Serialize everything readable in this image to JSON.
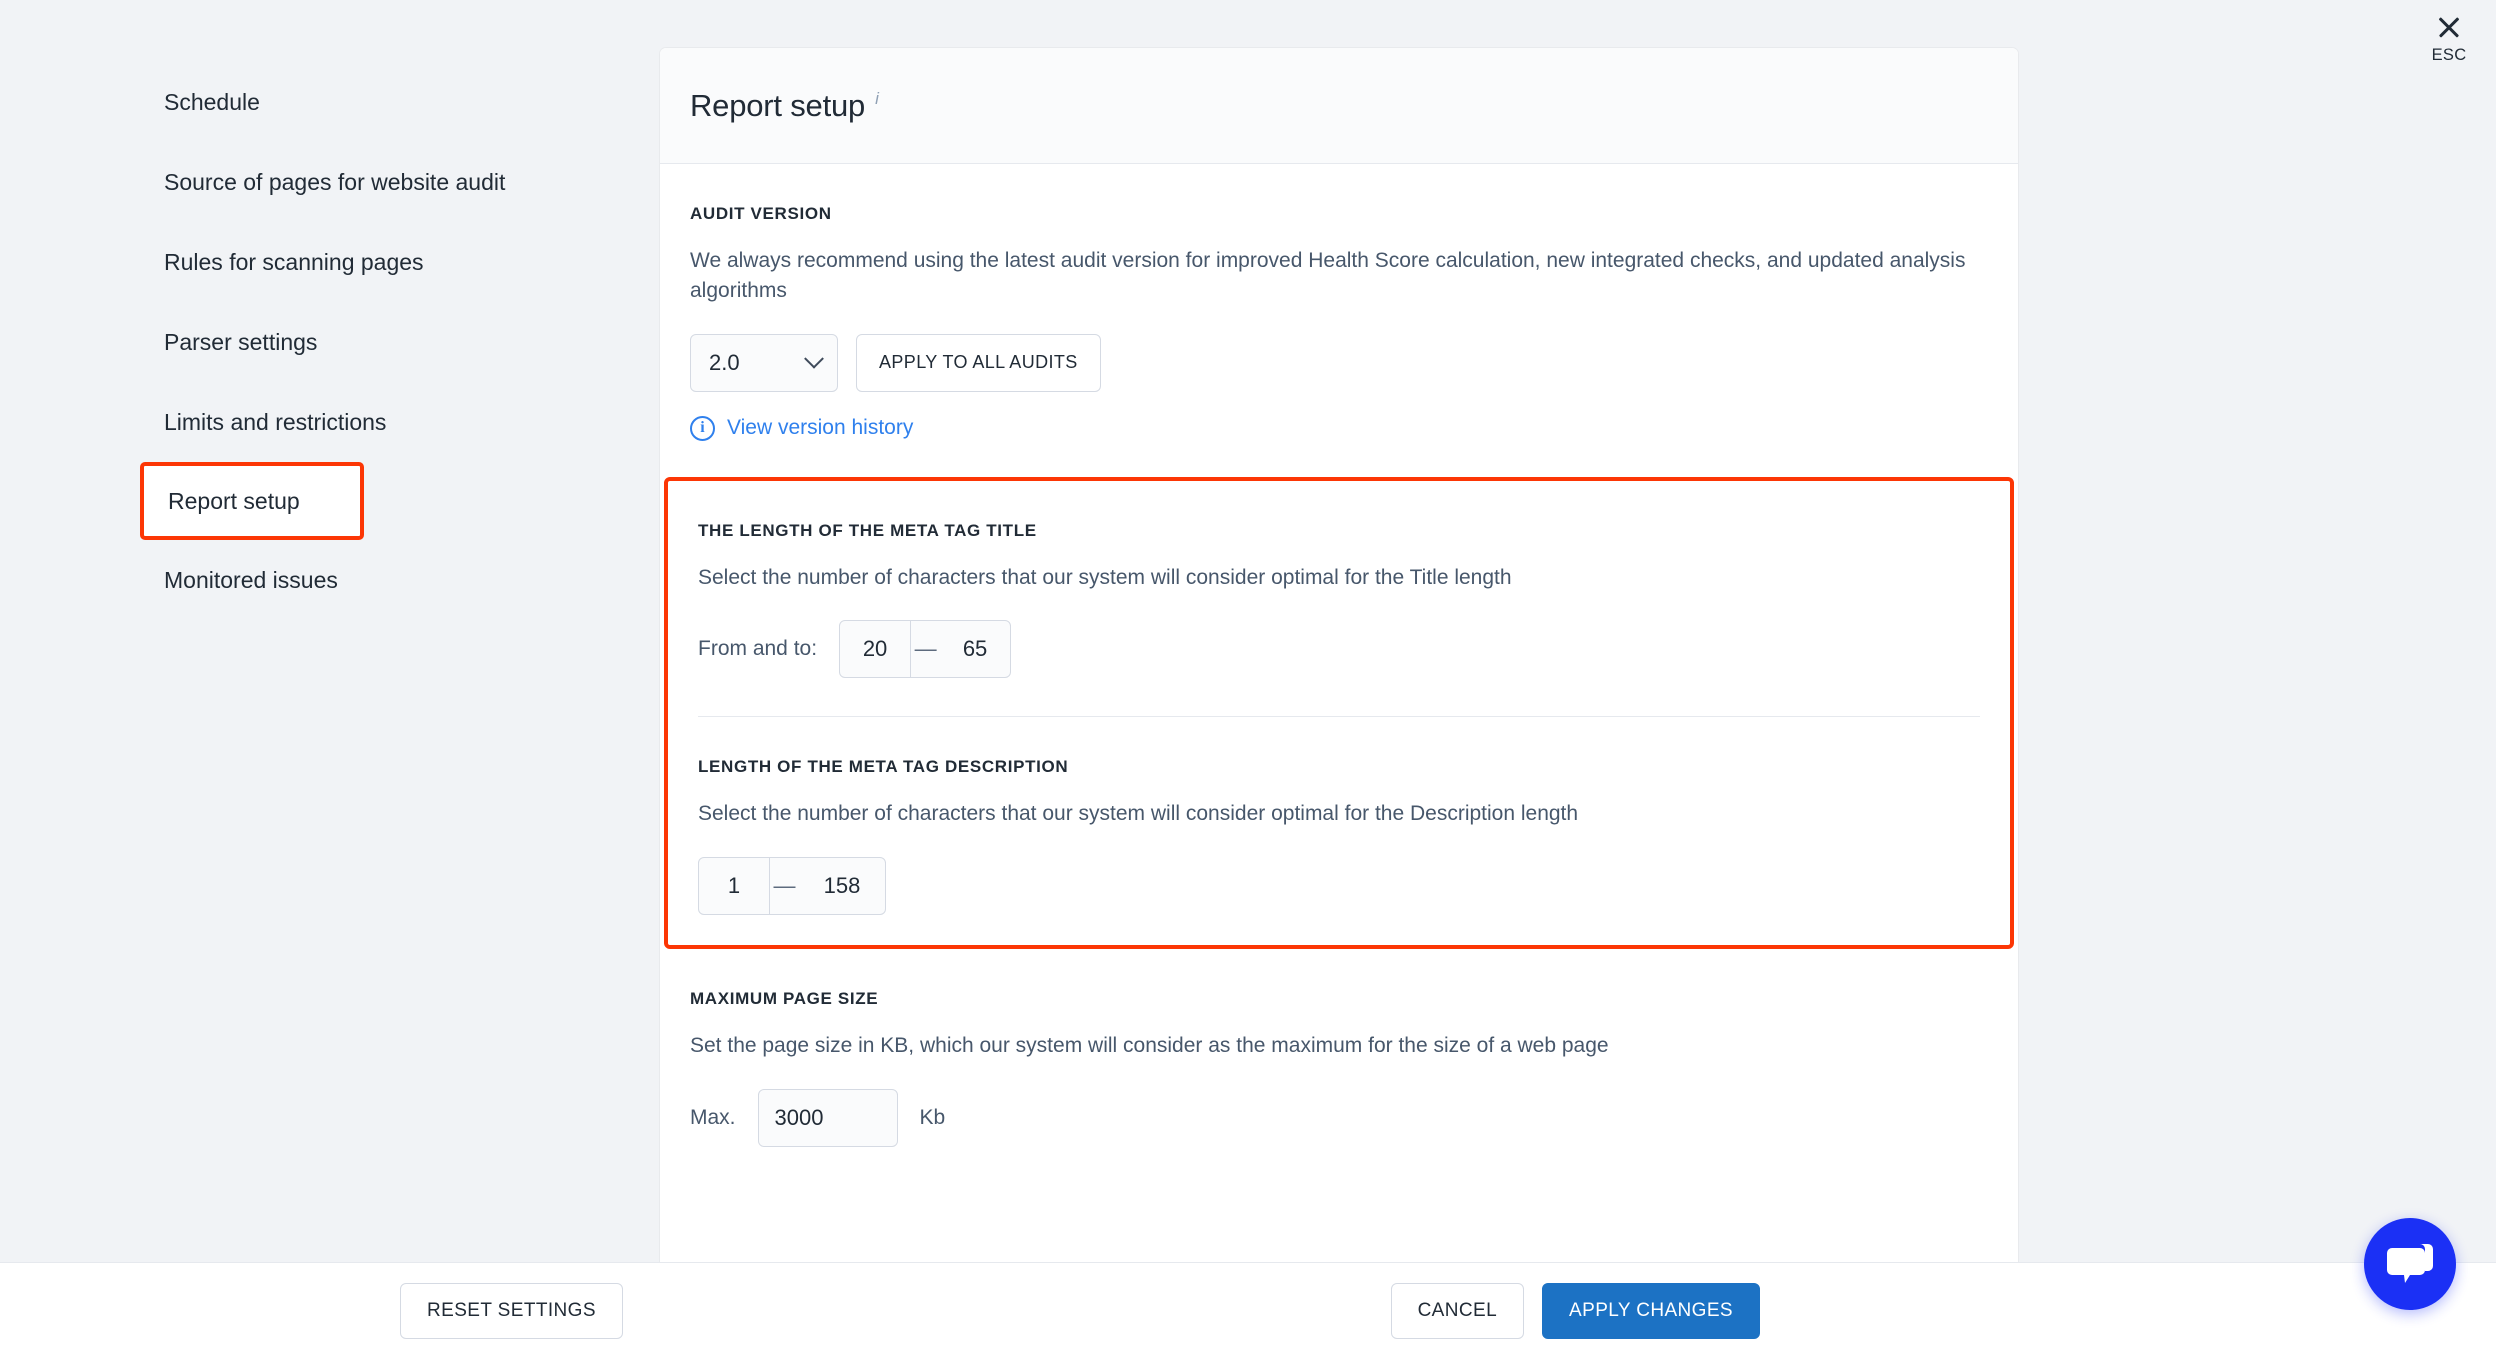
{
  "esc": {
    "label": "ESC",
    "icon": "close-icon"
  },
  "sidebar": {
    "items": [
      {
        "label": "Schedule",
        "highlighted": false
      },
      {
        "label": "Source of pages for website audit",
        "highlighted": false
      },
      {
        "label": "Rules for scanning pages",
        "highlighted": false
      },
      {
        "label": "Parser settings",
        "highlighted": false
      },
      {
        "label": "Limits and restrictions",
        "highlighted": false
      },
      {
        "label": "Report setup",
        "highlighted": true
      },
      {
        "label": "Monitored issues",
        "highlighted": false
      }
    ]
  },
  "panel": {
    "title": "Report setup",
    "info_icon": "info-icon"
  },
  "audit_version": {
    "heading": "AUDIT VERSION",
    "description": "We always recommend using the latest audit version for improved Health Score calculation, new integrated checks, and updated analysis algorithms",
    "select_value": "2.0",
    "select_options": [
      "2.0"
    ],
    "apply_all_label": "APPLY TO ALL AUDITS",
    "history_link": "View version history",
    "history_icon": "info-circle-icon"
  },
  "meta_title": {
    "heading": "THE LENGTH OF THE META TAG TITLE",
    "description": "Select the number of characters that our system will consider optimal for the Title length",
    "field_label": "From and to:",
    "from_value": "20",
    "separator": "—",
    "to_value": "65"
  },
  "meta_description": {
    "heading": "LENGTH OF THE META TAG DESCRIPTION",
    "description": "Select the number of characters that our system will consider optimal for the Description length",
    "from_value": "1",
    "separator": "—",
    "to_value": "158"
  },
  "page_size": {
    "heading": "MAXIMUM PAGE SIZE",
    "description": "Set the page size in KB, which our system will consider as the maximum for the size of a web page",
    "field_label": "Max.",
    "value": "3000",
    "unit": "Kb"
  },
  "footer": {
    "reset_label": "RESET SETTINGS",
    "cancel_label": "CANCEL",
    "apply_label": "APPLY CHANGES"
  },
  "chat": {
    "icon": "chat-bubble-icon"
  },
  "colors": {
    "highlight": "#fc3605",
    "primary": "#1c72c4",
    "link": "#2f80ed",
    "chat": "#1b30f5"
  }
}
